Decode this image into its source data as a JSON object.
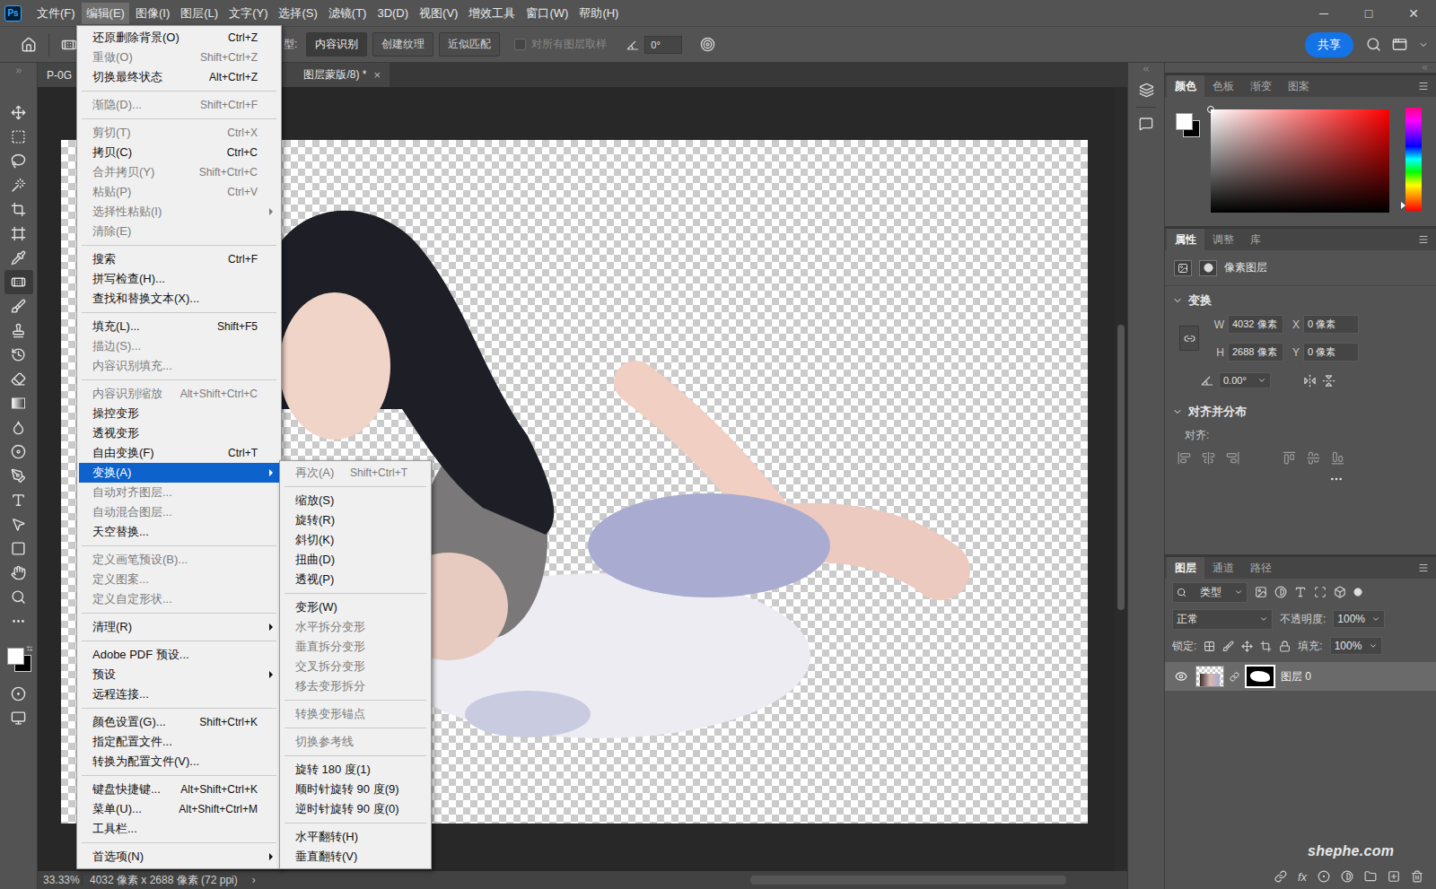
{
  "app": {
    "logo": "Ps"
  },
  "menubar": [
    {
      "label": "文件(F)",
      "selected": false
    },
    {
      "label": "编辑(E)",
      "selected": true
    },
    {
      "label": "图像(I)",
      "selected": false
    },
    {
      "label": "图层(L)",
      "selected": false
    },
    {
      "label": "文字(Y)",
      "selected": false
    },
    {
      "label": "选择(S)",
      "selected": false
    },
    {
      "label": "滤镜(T)",
      "selected": false
    },
    {
      "label": "3D(D)",
      "selected": false
    },
    {
      "label": "视图(V)",
      "selected": false
    },
    {
      "label": "增效工具",
      "selected": false
    },
    {
      "label": "窗口(W)",
      "selected": false
    },
    {
      "label": "帮助(H)",
      "selected": false
    }
  ],
  "window_controls": [
    "─",
    "□",
    "✕"
  ],
  "options_bar": {
    "type_label": "型:",
    "types": [
      {
        "label": "内容识别",
        "selected": true
      },
      {
        "label": "创建纹理",
        "selected": false
      },
      {
        "label": "近似匹配",
        "selected": false
      }
    ],
    "sample_all": {
      "label": "对所有图层取样",
      "checked": false,
      "disabled": true
    },
    "angle": "0°",
    "share": "共享"
  },
  "document_tab": {
    "title_parts": [
      "P-0G",
      "图层蒙版/8) *"
    ],
    "close": "×",
    "selected": true
  },
  "tools": [
    {
      "selected": false
    },
    {
      "selected": false
    },
    {
      "selected": false
    },
    {
      "selected": false
    },
    {
      "selected": false
    },
    {
      "selected": false
    },
    {
      "selected": false
    },
    {
      "selected": true
    },
    {
      "selected": false
    },
    {
      "selected": false
    },
    {
      "selected": false
    },
    {
      "selected": false
    },
    {
      "selected": false
    },
    {
      "selected": false
    },
    {
      "selected": false
    },
    {
      "selected": false
    },
    {
      "selected": false
    },
    {
      "selected": false
    },
    {
      "selected": false
    },
    {
      "selected": false
    },
    {
      "selected": false
    }
  ],
  "colors": {
    "foreground": "#ffffff",
    "background": "#000000"
  },
  "edit_menu": [
    {
      "kind": "item",
      "label": "还原删除背景(O)",
      "shortcut": "Ctrl+Z",
      "disabled": false,
      "selected": false,
      "submenu": false
    },
    {
      "kind": "item",
      "label": "重做(O)",
      "shortcut": "Shift+Ctrl+Z",
      "disabled": true,
      "selected": false,
      "submenu": false
    },
    {
      "kind": "item",
      "label": "切换最终状态",
      "shortcut": "Alt+Ctrl+Z",
      "disabled": false,
      "selected": false,
      "submenu": false
    },
    {
      "kind": "separator"
    },
    {
      "kind": "item",
      "label": "渐隐(D)...",
      "shortcut": "Shift+Ctrl+F",
      "disabled": true,
      "selected": false,
      "submenu": false
    },
    {
      "kind": "separator"
    },
    {
      "kind": "item",
      "label": "剪切(T)",
      "shortcut": "Ctrl+X",
      "disabled": true,
      "selected": false,
      "submenu": false
    },
    {
      "kind": "item",
      "label": "拷贝(C)",
      "shortcut": "Ctrl+C",
      "disabled": false,
      "selected": false,
      "submenu": false
    },
    {
      "kind": "item",
      "label": "合并拷贝(Y)",
      "shortcut": "Shift+Ctrl+C",
      "disabled": true,
      "selected": false,
      "submenu": false
    },
    {
      "kind": "item",
      "label": "粘贴(P)",
      "shortcut": "Ctrl+V",
      "disabled": true,
      "selected": false,
      "submenu": false
    },
    {
      "kind": "item",
      "label": "选择性粘贴(I)",
      "shortcut": "",
      "disabled": true,
      "selected": false,
      "submenu": true
    },
    {
      "kind": "item",
      "label": "清除(E)",
      "shortcut": "",
      "disabled": true,
      "selected": false,
      "submenu": false
    },
    {
      "kind": "separator"
    },
    {
      "kind": "item",
      "label": "搜索",
      "shortcut": "Ctrl+F",
      "disabled": false,
      "selected": false,
      "submenu": false
    },
    {
      "kind": "item",
      "label": "拼写检查(H)...",
      "shortcut": "",
      "disabled": false,
      "selected": false,
      "submenu": false
    },
    {
      "kind": "item",
      "label": "查找和替换文本(X)...",
      "shortcut": "",
      "disabled": false,
      "selected": false,
      "submenu": false
    },
    {
      "kind": "separator"
    },
    {
      "kind": "item",
      "label": "填充(L)...",
      "shortcut": "Shift+F5",
      "disabled": false,
      "selected": false,
      "submenu": false
    },
    {
      "kind": "item",
      "label": "描边(S)...",
      "shortcut": "",
      "disabled": true,
      "selected": false,
      "submenu": false
    },
    {
      "kind": "item",
      "label": "内容识别填充...",
      "shortcut": "",
      "disabled": true,
      "selected": false,
      "submenu": false
    },
    {
      "kind": "separator"
    },
    {
      "kind": "item",
      "label": "内容识别缩放",
      "shortcut": "Alt+Shift+Ctrl+C",
      "disabled": true,
      "selected": false,
      "submenu": false
    },
    {
      "kind": "item",
      "label": "操控变形",
      "shortcut": "",
      "disabled": false,
      "selected": false,
      "submenu": false
    },
    {
      "kind": "item",
      "label": "透视变形",
      "shortcut": "",
      "disabled": false,
      "selected": false,
      "submenu": false
    },
    {
      "kind": "item",
      "label": "自由变换(F)",
      "shortcut": "Ctrl+T",
      "disabled": false,
      "selected": false,
      "submenu": false
    },
    {
      "kind": "item",
      "label": "变换(A)",
      "shortcut": "",
      "disabled": false,
      "selected": true,
      "submenu": true
    },
    {
      "kind": "item",
      "label": "自动对齐图层...",
      "shortcut": "",
      "disabled": true,
      "selected": false,
      "submenu": false
    },
    {
      "kind": "item",
      "label": "自动混合图层...",
      "shortcut": "",
      "disabled": true,
      "selected": false,
      "submenu": false
    },
    {
      "kind": "item",
      "label": "天空替换...",
      "shortcut": "",
      "disabled": false,
      "selected": false,
      "submenu": false
    },
    {
      "kind": "separator"
    },
    {
      "kind": "item",
      "label": "定义画笔预设(B)...",
      "shortcut": "",
      "disabled": true,
      "selected": false,
      "submenu": false
    },
    {
      "kind": "item",
      "label": "定义图案...",
      "shortcut": "",
      "disabled": true,
      "selected": false,
      "submenu": false
    },
    {
      "kind": "item",
      "label": "定义自定形状...",
      "shortcut": "",
      "disabled": true,
      "selected": false,
      "submenu": false
    },
    {
      "kind": "separator"
    },
    {
      "kind": "item",
      "label": "清理(R)",
      "shortcut": "",
      "disabled": false,
      "selected": false,
      "submenu": true
    },
    {
      "kind": "separator"
    },
    {
      "kind": "item",
      "label": "Adobe PDF 预设...",
      "shortcut": "",
      "disabled": false,
      "selected": false,
      "submenu": false
    },
    {
      "kind": "item",
      "label": "预设",
      "shortcut": "",
      "disabled": false,
      "selected": false,
      "submenu": true
    },
    {
      "kind": "item",
      "label": "远程连接...",
      "shortcut": "",
      "disabled": false,
      "selected": false,
      "submenu": false
    },
    {
      "kind": "separator"
    },
    {
      "kind": "item",
      "label": "颜色设置(G)...",
      "shortcut": "Shift+Ctrl+K",
      "disabled": false,
      "selected": false,
      "submenu": false
    },
    {
      "kind": "item",
      "label": "指定配置文件...",
      "shortcut": "",
      "disabled": false,
      "selected": false,
      "submenu": false
    },
    {
      "kind": "item",
      "label": "转换为配置文件(V)...",
      "shortcut": "",
      "disabled": false,
      "selected": false,
      "submenu": false
    },
    {
      "kind": "separator"
    },
    {
      "kind": "item",
      "label": "键盘快捷键...",
      "shortcut": "Alt+Shift+Ctrl+K",
      "disabled": false,
      "selected": false,
      "submenu": false
    },
    {
      "kind": "item",
      "label": "菜单(U)...",
      "shortcut": "Alt+Shift+Ctrl+M",
      "disabled": false,
      "selected": false,
      "submenu": false
    },
    {
      "kind": "item",
      "label": "工具栏...",
      "shortcut": "",
      "disabled": false,
      "selected": false,
      "submenu": false
    },
    {
      "kind": "separator"
    },
    {
      "kind": "item",
      "label": "首选项(N)",
      "shortcut": "",
      "disabled": false,
      "selected": false,
      "submenu": true
    }
  ],
  "transform_submenu": [
    {
      "kind": "item",
      "label": "再次(A)",
      "shortcut": "Shift+Ctrl+T",
      "disabled": true,
      "selected": false,
      "submenu": false
    },
    {
      "kind": "separator"
    },
    {
      "kind": "item",
      "label": "缩放(S)",
      "shortcut": "",
      "disabled": false,
      "selected": false,
      "submenu": false
    },
    {
      "kind": "item",
      "label": "旋转(R)",
      "shortcut": "",
      "disabled": false,
      "selected": false,
      "submenu": false
    },
    {
      "kind": "item",
      "label": "斜切(K)",
      "shortcut": "",
      "disabled": false,
      "selected": false,
      "submenu": false
    },
    {
      "kind": "item",
      "label": "扭曲(D)",
      "shortcut": "",
      "disabled": false,
      "selected": false,
      "submenu": false
    },
    {
      "kind": "item",
      "label": "透视(P)",
      "shortcut": "",
      "disabled": false,
      "selected": false,
      "submenu": false
    },
    {
      "kind": "separator"
    },
    {
      "kind": "item",
      "label": "变形(W)",
      "shortcut": "",
      "disabled": false,
      "selected": false,
      "submenu": false
    },
    {
      "kind": "item",
      "label": "水平拆分变形",
      "shortcut": "",
      "disabled": true,
      "selected": false,
      "submenu": false
    },
    {
      "kind": "item",
      "label": "垂直拆分变形",
      "shortcut": "",
      "disabled": true,
      "selected": false,
      "submenu": false
    },
    {
      "kind": "item",
      "label": "交叉拆分变形",
      "shortcut": "",
      "disabled": true,
      "selected": false,
      "submenu": false
    },
    {
      "kind": "item",
      "label": "移去变形拆分",
      "shortcut": "",
      "disabled": true,
      "selected": false,
      "submenu": false
    },
    {
      "kind": "separator"
    },
    {
      "kind": "item",
      "label": "转换变形锚点",
      "shortcut": "",
      "disabled": true,
      "selected": false,
      "submenu": false
    },
    {
      "kind": "separator"
    },
    {
      "kind": "item",
      "label": "切换参考线",
      "shortcut": "",
      "disabled": true,
      "selected": false,
      "submenu": false
    },
    {
      "kind": "separator"
    },
    {
      "kind": "item",
      "label": "旋转 180 度(1)",
      "shortcut": "",
      "disabled": false,
      "selected": false,
      "submenu": false
    },
    {
      "kind": "item",
      "label": "顺时针旋转 90 度(9)",
      "shortcut": "",
      "disabled": false,
      "selected": false,
      "submenu": false
    },
    {
      "kind": "item",
      "label": "逆时针旋转 90 度(0)",
      "shortcut": "",
      "disabled": false,
      "selected": false,
      "submenu": false
    },
    {
      "kind": "separator"
    },
    {
      "kind": "item",
      "label": "水平翻转(H)",
      "shortcut": "",
      "disabled": false,
      "selected": false,
      "submenu": false
    },
    {
      "kind": "item",
      "label": "垂直翻转(V)",
      "shortcut": "",
      "disabled": false,
      "selected": false,
      "submenu": false
    }
  ],
  "color_panel": {
    "tabs": [
      {
        "label": "颜色",
        "selected": true
      },
      {
        "label": "色板",
        "selected": false
      },
      {
        "label": "渐变",
        "selected": false
      },
      {
        "label": "图案",
        "selected": false
      }
    ],
    "hue_color": "#ff0000",
    "hue_level": 0.98
  },
  "properties_panel": {
    "tabs": [
      {
        "label": "属性",
        "selected": true
      },
      {
        "label": "调整",
        "selected": false
      },
      {
        "label": "库",
        "selected": false
      }
    ],
    "layer_kind": "像素图层",
    "transform": {
      "title": "变换",
      "expanded": true,
      "fields": [
        {
          "label": "W",
          "value": "4032 像素"
        },
        {
          "label": "X",
          "value": "0 像素"
        },
        {
          "label": "H",
          "value": "2688 像素"
        },
        {
          "label": "Y",
          "value": "0 像素"
        }
      ],
      "angle": "0.00°"
    },
    "align": {
      "title": "对齐并分布",
      "expanded": true,
      "label": "对齐:"
    }
  },
  "layers_panel": {
    "tabs": [
      {
        "label": "图层",
        "selected": true
      },
      {
        "label": "通道",
        "selected": false
      },
      {
        "label": "路径",
        "selected": false
      }
    ],
    "filter": "类型",
    "blend_mode": "正常",
    "opacity_label": "不透明度:",
    "opacity": "100%",
    "lock_label": "锁定:",
    "fill_label": "填充:",
    "fill": "100%",
    "layers": [
      {
        "name": "图层 0",
        "visible": true,
        "selected": true
      }
    ],
    "fx": "fx"
  },
  "status_bar": {
    "zoom": "33.33%",
    "info": "4032 像素 x 2688 像素 (72 ppi)",
    "arrow": "›"
  },
  "scrollbars": {
    "vertical": {
      "offset": 0.3,
      "level": 0.37
    },
    "horizontal": {
      "offset": 0.46,
      "level": 0.5
    }
  },
  "watermark": "shephe.com"
}
